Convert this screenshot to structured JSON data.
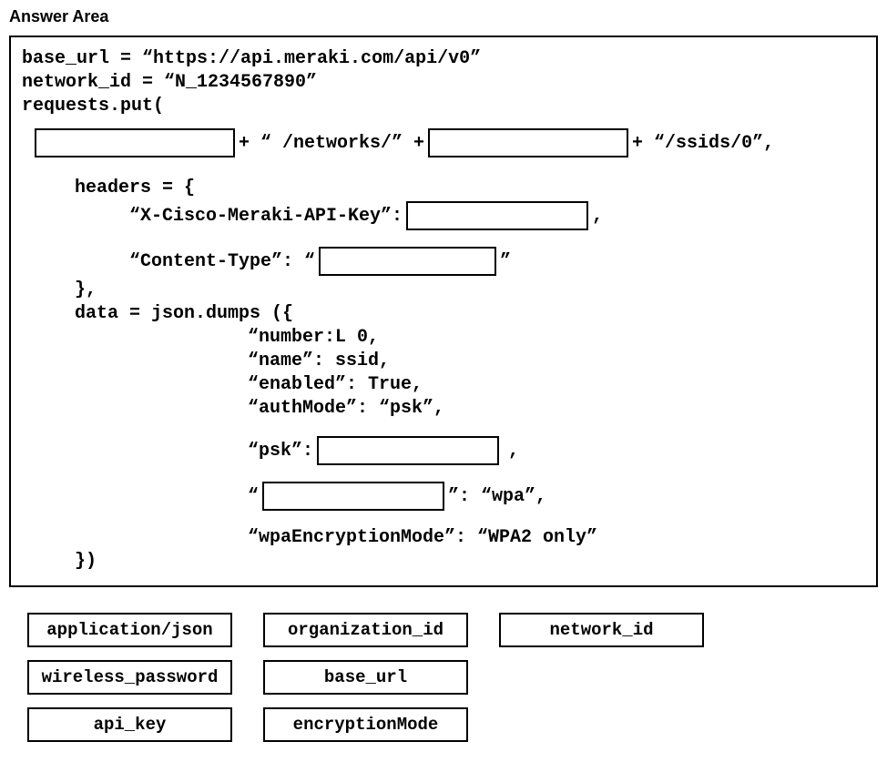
{
  "title": "Answer Area",
  "code": {
    "l1": "base_url = “https://api.meraki.com/api/v0”",
    "l2": "network_id = “N_1234567890”",
    "l3": "requests.put(",
    "seg_plus1": "+ “ /networks/” + ",
    "seg_plus2": " + “/ssids/0”,",
    "headers_open": "headers = {",
    "header_key": "“X-Cisco-Meraki-API-Key”: ",
    "comma": ",",
    "content_type_pre": "“Content-Type”: “",
    "content_type_post": "”",
    "close_brace_comma": "},",
    "data_open": "data = json.dumps ({",
    "d1": "“number:L 0,",
    "d2": "“name”: ssid,",
    "d3": "“enabled”: True,",
    "d4": "“authMode”: “psk”,",
    "psk_pre": "“psk”: ",
    "quote_open": "“",
    "wpa_post": "”: “wpa”,",
    "wpa_enc": "“wpaEncryptionMode”: “WPA2 only”",
    "close_paren": "})"
  },
  "options": {
    "r1c1": "application/json",
    "r1c2": "organization_id",
    "r1c3": "network_id",
    "r2c1": "wireless_password",
    "r2c2": "base_url",
    "r3c1": "api_key",
    "r3c2": "encryptionMode"
  }
}
